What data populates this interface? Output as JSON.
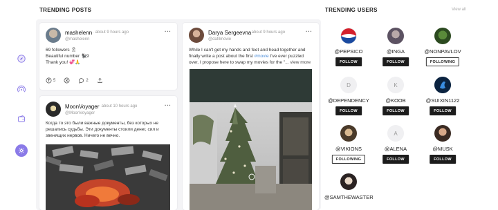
{
  "sections": {
    "trending_posts": "TRENDING POSTS",
    "trending_users": "TRENDING USERS",
    "view_all": "View all"
  },
  "nav": {
    "icons": [
      "compass-icon",
      "broadcast-icon",
      "wallet-icon",
      "settings-icon"
    ],
    "accent_color": "#8a7ae8"
  },
  "posts": [
    {
      "name": "mashelenn",
      "time": "· about 9 hours ago",
      "handle": "@mashelenn",
      "lines": [
        "69 followers 🎗",
        "Beautiful number 🐈‍⬛9",
        "Thank you! 💞🙏"
      ],
      "likes": "5",
      "comments": "2"
    },
    {
      "name": "Darya Sergeevna",
      "time": "· about 9 hours ago",
      "handle": "@dafilmovie",
      "line1": "While I can't get my hands and feet and head together and",
      "line2a": "finally write a post about the first ",
      "hashtag": "#movie",
      "line2b": " I've ever puzzled",
      "line3a": "over, I propose here to swap my movies for the \"...",
      "more": "view more"
    },
    {
      "name": "MoonVoyager",
      "time": "· about 10 hours ago",
      "handle": "@MoonVoyager",
      "lines": [
        "Когда то это были важные документы, без которых не",
        "решались судьбы. Эти документы стоили денег, сил и",
        "звенящих нервов. Ничего не вечно."
      ]
    }
  ],
  "users": [
    {
      "name": "@PEPSICO",
      "button": "FOLLOW",
      "style": "dark"
    },
    {
      "name": "@INGA",
      "button": "FOLLOW",
      "style": "dark"
    },
    {
      "name": "@NONPAVLOV",
      "button": "FOLLOWING",
      "style": "light"
    },
    {
      "name": "@DEPENDENCY",
      "button": "FOLLOW",
      "style": "dark",
      "initial": "D"
    },
    {
      "name": "@KOOB",
      "button": "FOLLOW",
      "style": "dark",
      "initial": "K"
    },
    {
      "name": "@SUIXIN1122",
      "button": "FOLLOW",
      "style": "dark"
    },
    {
      "name": "@VIKIONS",
      "button": "FOLLOWING",
      "style": "light"
    },
    {
      "name": "@ALENA",
      "button": "FOLLOW",
      "style": "dark",
      "initial": "A"
    },
    {
      "name": "@MUSK",
      "button": "FOLLOW",
      "style": "dark"
    },
    {
      "name": "@SAMTHEWASTER",
      "button": "",
      "style": "none"
    }
  ]
}
